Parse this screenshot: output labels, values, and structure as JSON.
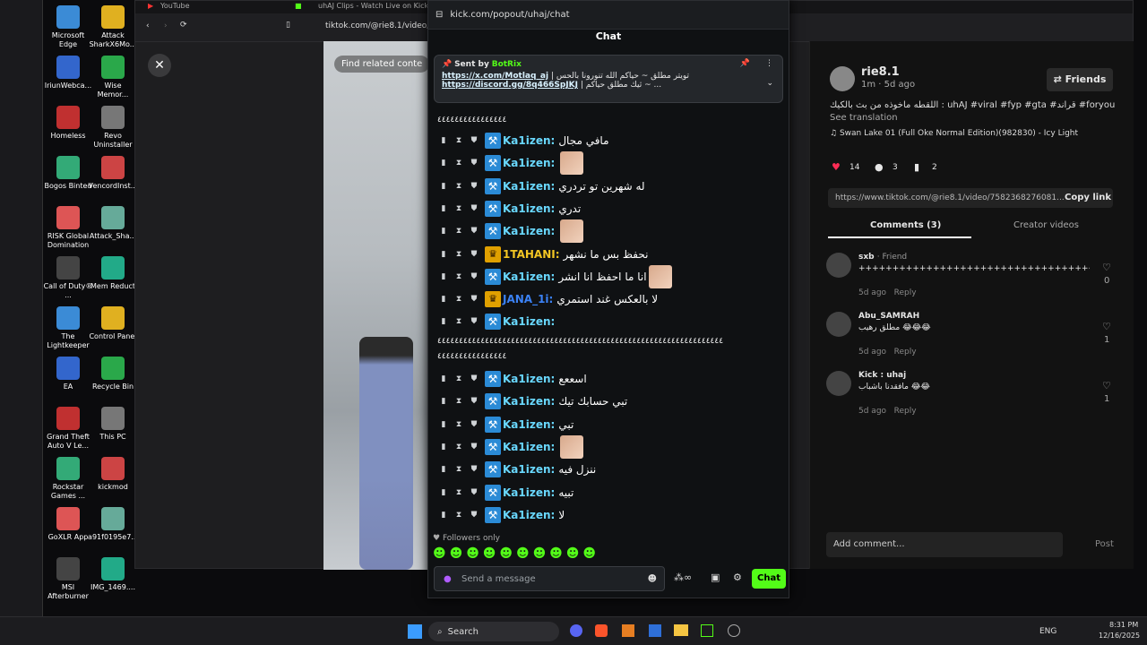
{
  "desktop_icons": [
    {
      "label": "Microsoft Edge",
      "x": "l",
      "row": 0
    },
    {
      "label": "Attack SharkX6Mo...",
      "x": "r",
      "row": 0
    },
    {
      "label": "IriunWebca...",
      "x": "l",
      "row": 1
    },
    {
      "label": "Wise Memor...",
      "x": "r",
      "row": 1
    },
    {
      "label": "Homeless",
      "x": "l",
      "row": 2
    },
    {
      "label": "Revo Uninstaller",
      "x": "r",
      "row": 2
    },
    {
      "label": "Bogos Binted",
      "x": "l",
      "row": 3
    },
    {
      "label": "VencordInst...",
      "x": "r",
      "row": 3
    },
    {
      "label": "RISK Global Domination",
      "x": "l",
      "row": 4
    },
    {
      "label": "Attack_Sha...",
      "x": "r",
      "row": 4
    },
    {
      "label": "Call of Duty® ...",
      "x": "l",
      "row": 5
    },
    {
      "label": "Mem Reduct",
      "x": "r",
      "row": 5
    },
    {
      "label": "The Lightkeeper",
      "x": "l",
      "row": 6
    },
    {
      "label": "Control Panel",
      "x": "r",
      "row": 6
    },
    {
      "label": "EA",
      "x": "l",
      "row": 7
    },
    {
      "label": "Recycle Bin",
      "x": "r",
      "row": 7
    },
    {
      "label": "Grand Theft Auto V Le...",
      "x": "l",
      "row": 8
    },
    {
      "label": "This PC",
      "x": "r",
      "row": 8
    },
    {
      "label": "Rockstar Games ...",
      "x": "l",
      "row": 9
    },
    {
      "label": "kickmod",
      "x": "r",
      "row": 9
    },
    {
      "label": "GoXLR App",
      "x": "l",
      "row": 10
    },
    {
      "label": "a91f0195e7...",
      "x": "r",
      "row": 10
    },
    {
      "label": "MSI Afterburner",
      "x": "l",
      "row": 11
    },
    {
      "label": "IMG_1469....",
      "x": "r",
      "row": 11
    }
  ],
  "bg_browser": {
    "tab1": "YouTube",
    "tab2": "uhAJ Clips - Watch Live on Kick",
    "url": "tiktok.com/@rie8.1/video/7",
    "find_related": "Find related conte"
  },
  "tiktok": {
    "username": "rie8.1",
    "meta": "1m · 5d ago",
    "friends_btn": "Friends",
    "caption": "اللقطه ماخوذه من بث بالكيك : uhAJ #viral #fyp #gta #قراند #foryou",
    "see_translation": "See translation",
    "music": "Swan Lake 01 (Full Oke Normal Edition)(982830) - Icy Light",
    "likes": "14",
    "comments": "3",
    "saves": "2",
    "link": "https://www.tiktok.com/@rie8.1/video/7582368276081...",
    "copy_link": "Copy link",
    "tab_comments": "Comments (3)",
    "tab_creator": "Creator videos",
    "comment_list": [
      {
        "user": "sxb",
        "tag": "· Friend",
        "text": "+++++++++++++++++++++++++++++++++++++++++++++++++++++",
        "time": "5d ago",
        "reply": "Reply",
        "likes": "0"
      },
      {
        "user": "Abu_SAMRAH",
        "tag": "",
        "text": "مطلق رهيب 😂😂😂",
        "time": "5d ago",
        "reply": "Reply",
        "likes": "1"
      },
      {
        "user": "Kick : uhaj",
        "tag": "",
        "text": "مافقدنا باشباب 😂😂",
        "time": "5d ago",
        "reply": "Reply",
        "likes": "1"
      }
    ],
    "add_comment": "Add comment...",
    "post": "Post"
  },
  "kick": {
    "url": "kick.com/popout/uhaj/chat",
    "title": "Chat",
    "pinned_sent_by": "Sent by",
    "pinned_user": "BotRix",
    "pinned_line1_link": "https://x.com/Motlaq_aj",
    "pinned_line1_text": "| تويتر مطلق ~ حياكم الله تنورونا بالحس",
    "pinned_line2_link": "https://discord.gg/8q466SpJKJ",
    "pinned_line2_text": "| ثيك مطلق حياكم ~ ...",
    "long_line1": "٤٤٤٤٤٤٤٤٤٤٤٤٤٤٤٤",
    "messages": [
      {
        "user": "Ka1izen:",
        "text": "مافي مجال",
        "emote": false,
        "crown": false
      },
      {
        "user": "Ka1izen:",
        "text": "",
        "emote": true,
        "crown": false
      },
      {
        "user": "Ka1izen:",
        "text": "له شهرين تو تردري",
        "emote": false,
        "crown": false
      },
      {
        "user": "Ka1izen:",
        "text": "تدري",
        "emote": false,
        "crown": false
      },
      {
        "user": "Ka1izen:",
        "text": "",
        "emote": true,
        "crown": false
      },
      {
        "user": "1TAHANI:",
        "text": "نحفظ بس ما نشهر",
        "emote": false,
        "crown": true
      },
      {
        "user": "Ka1izen:",
        "text": "انا ما احفظ انا انشر",
        "emote": true,
        "crown": false
      },
      {
        "user": "JANA_1i:",
        "text": "لا بالعكس غند استمري",
        "emote": false,
        "crown": true
      },
      {
        "user": "Ka1izen:",
        "text": "",
        "emote": false,
        "crown": false
      }
    ],
    "long_line2": "٤٤٤٤٤٤٤٤٤٤٤٤٤٤٤٤٤٤٤٤٤٤٤٤٤٤٤٤٤٤٤٤٤٤٤٤٤٤٤٤٤٤٤٤٤٤٤٤٤٤٤٤٤٤٤٤٤٤٤٤٤٤٤٤٤٤",
    "long_line3": "٤٤٤٤٤٤٤٤٤٤٤٤٤٤٤٤",
    "messages2": [
      {
        "user": "Ka1izen:",
        "text": "اسععع",
        "emote": false
      },
      {
        "user": "Ka1izen:",
        "text": "تبي حسابك تيك",
        "emote": false
      },
      {
        "user": "Ka1izen:",
        "text": "تبي",
        "emote": false
      },
      {
        "user": "Ka1izen:",
        "text": "",
        "emote": true
      },
      {
        "user": "Ka1izen:",
        "text": "ننزل فيه",
        "emote": false
      },
      {
        "user": "Ka1izen:",
        "text": "تبيه",
        "emote": false
      },
      {
        "user": "Ka1izen:",
        "text": "لا",
        "emote": false
      }
    ],
    "followers_only": "Followers only",
    "input_placeholder": "Send a message",
    "chat_button": "Chat"
  },
  "taskbar": {
    "search": "Search",
    "lang": "ENG",
    "time": "8:31 PM",
    "date": "12/16/2025"
  }
}
